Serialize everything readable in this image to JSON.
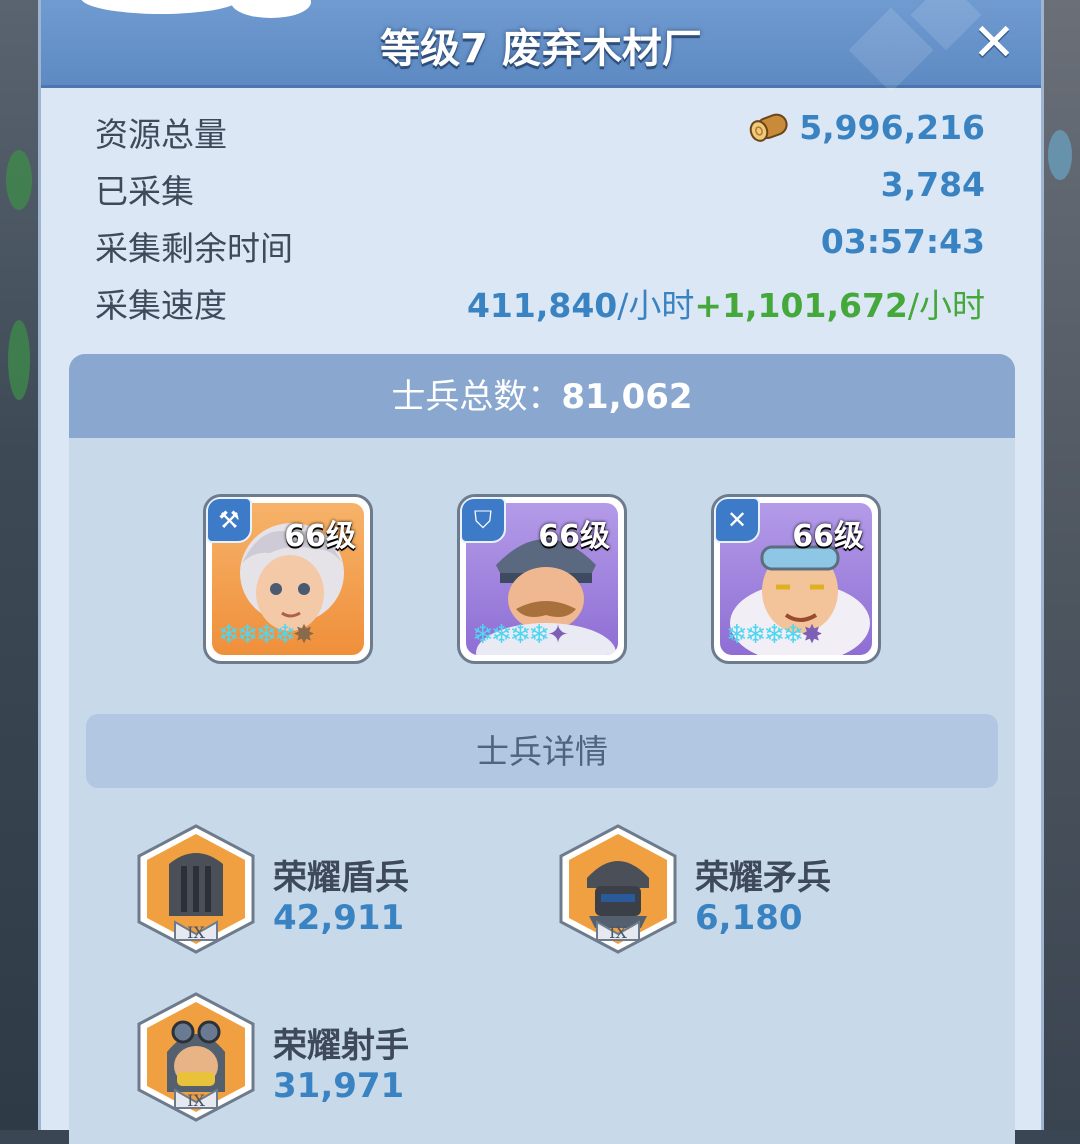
{
  "dialog": {
    "title": "等级7 废弃木材厂",
    "close_icon": "close-icon"
  },
  "info": {
    "total_label": "资源总量",
    "total_value": "5,996,216",
    "resource_icon": "wood-log-icon",
    "collected_label": "已采集",
    "collected_value": "3,784",
    "time_label": "采集剩余时间",
    "time_value": "03:57:43",
    "speed_label": "采集速度",
    "speed_base": "411,840",
    "speed_unit": "/小时",
    "speed_plus": "+",
    "speed_bonus": "1,101,672",
    "speed_unit2": "/小时"
  },
  "troops": {
    "total_label": "士兵总数：",
    "total_value": "81,062",
    "heroes": [
      {
        "level": "66级",
        "role_icon": "shovel-icon",
        "stars_filled": 4,
        "stars_total": 5,
        "color": "#f0a050"
      },
      {
        "level": "66级",
        "role_icon": "shield-icon",
        "stars_filled": 4,
        "stars_total": 5,
        "color": "#9b7ad8"
      },
      {
        "level": "66级",
        "role_icon": "crossbow-icon",
        "stars_filled": 4,
        "stars_total": 5,
        "color": "#9b7ad8"
      }
    ],
    "details_label": "士兵详情",
    "units": [
      {
        "name": "荣耀盾兵",
        "count": "42,911",
        "tier": "IX"
      },
      {
        "name": "荣耀矛兵",
        "count": "6,180",
        "tier": "IX"
      },
      {
        "name": "荣耀射手",
        "count": "31,971",
        "tier": "IX"
      }
    ]
  },
  "colors": {
    "accent_blue": "#3a83c2",
    "bonus_green": "#44a83a",
    "header_blue": "#6f9bd1"
  }
}
